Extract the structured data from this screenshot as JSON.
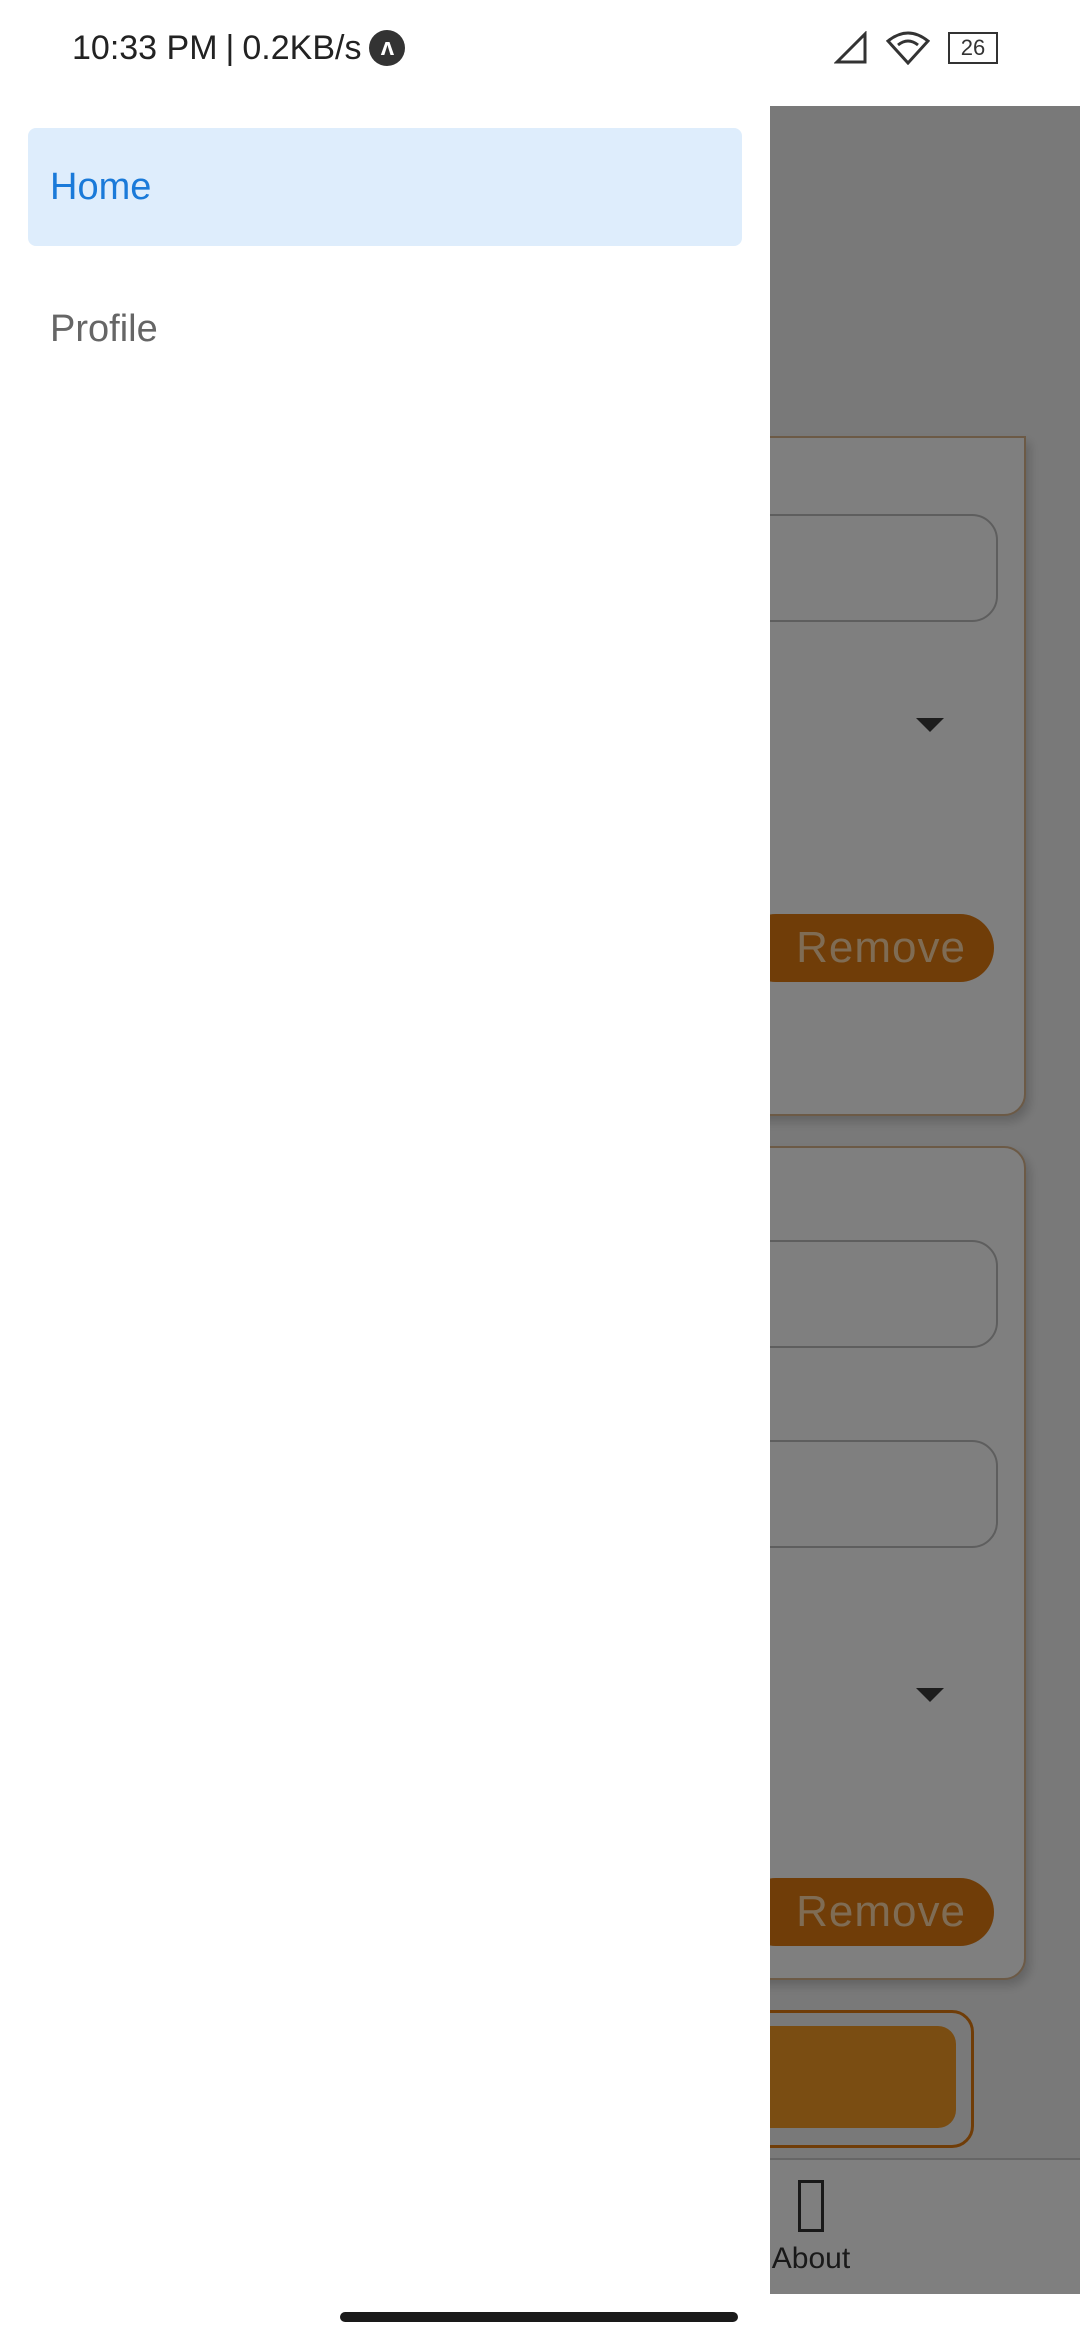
{
  "status_bar": {
    "time": "10:33 PM",
    "network_speed": "0.2KB/s",
    "separator": "|",
    "app_icon_glyph": "ʌ",
    "battery_level": "26",
    "icons": [
      "signal-icon",
      "wifi-icon",
      "battery-icon"
    ]
  },
  "drawer": {
    "items": [
      {
        "label": "Home",
        "active": true
      },
      {
        "label": "Profile",
        "active": false
      }
    ]
  },
  "background_page": {
    "remove_buttons": [
      "Remove",
      "Remove"
    ],
    "bottom_nav": {
      "about_label": "About"
    }
  },
  "colors": {
    "drawer_active_bg": "#deedfc",
    "drawer_active_text": "#1a7ad9",
    "accent_orange": "#e07a10",
    "scrim": "rgba(0,0,0,0.5)"
  }
}
